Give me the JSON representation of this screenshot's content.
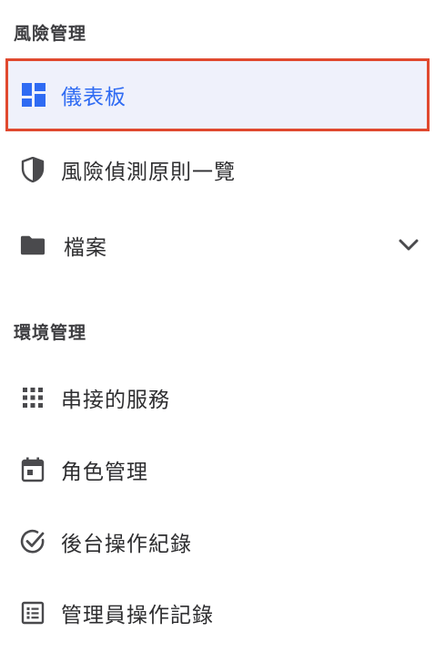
{
  "sections": [
    {
      "header": "風險管理",
      "items": [
        {
          "label": "儀表板",
          "icon": "dashboard-icon",
          "active": true
        },
        {
          "label": "風險偵測原則一覽",
          "icon": "shield-icon"
        },
        {
          "label": "檔案",
          "icon": "folder-icon",
          "expandable": true
        }
      ]
    },
    {
      "header": "環境管理",
      "items": [
        {
          "label": "串接的服務",
          "icon": "grid-dots-icon"
        },
        {
          "label": "角色管理",
          "icon": "calendar-icon"
        },
        {
          "label": "後台操作紀錄",
          "icon": "check-circle-icon"
        },
        {
          "label": "管理員操作記錄",
          "icon": "list-icon"
        }
      ]
    }
  ],
  "colors": {
    "accent": "#2f6bf3",
    "active_bg": "#eff1fb",
    "highlight_border": "#e0492f",
    "icon": "#4a4a4d",
    "text": "#2e2e30"
  }
}
